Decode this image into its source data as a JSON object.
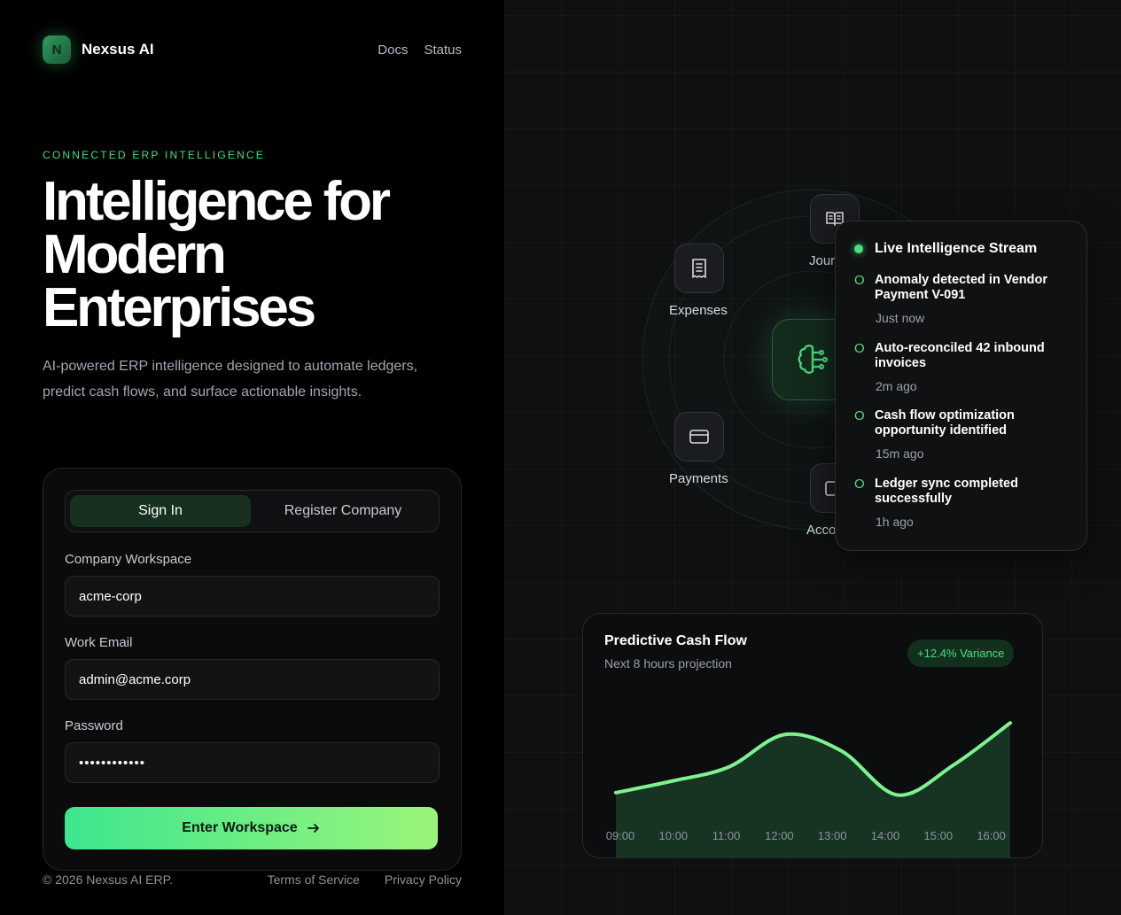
{
  "brand": {
    "logo_letter": "N",
    "name": "Nexsus AI"
  },
  "nav": {
    "docs": "Docs",
    "status": "Status"
  },
  "hero": {
    "eyebrow": "CONNECTED ERP INTELLIGENCE",
    "headline_line1": "Intelligence for",
    "headline_line2": "Modern",
    "headline_line3": "Enterprises",
    "subtext": "AI-powered ERP intelligence designed to automate ledgers, predict cash flows, and surface actionable insights."
  },
  "auth": {
    "tabs": {
      "sign_in": "Sign In",
      "register": "Register Company"
    },
    "workspace_label": "Company Workspace",
    "workspace_value": "acme-corp",
    "email_label": "Work Email",
    "email_value": "admin@acme.corp",
    "password_label": "Password",
    "password_value": "••••••••••••",
    "submit_label": "Enter Workspace"
  },
  "footer": {
    "copyright": "© 2026 Nexsus AI ERP.",
    "terms": "Terms of Service",
    "privacy": "Privacy Policy"
  },
  "modules": {
    "journal": {
      "label": "Journal",
      "icon": "book-open-icon"
    },
    "expenses": {
      "label": "Expenses",
      "icon": "receipt-icon"
    },
    "payments": {
      "label": "Payments",
      "icon": "credit-card-icon"
    },
    "accounts": {
      "label": "Accounts",
      "icon": "wallet-icon"
    },
    "core_icon": "brain-circuit-icon"
  },
  "stream": {
    "title": "Live Intelligence Stream",
    "events": [
      {
        "title": "Anomaly detected in Vendor Payment V-091",
        "time": "Just now"
      },
      {
        "title": "Auto-reconciled 42 inbound invoices",
        "time": "2m ago"
      },
      {
        "title": "Cash flow optimization opportunity identified",
        "time": "15m ago"
      },
      {
        "title": "Ledger sync completed successfully",
        "time": "1h ago"
      }
    ]
  },
  "cashflow": {
    "title": "Predictive Cash Flow",
    "subtitle": "Next 8 hours projection",
    "badge": "+12.4% Variance"
  },
  "chart_data": {
    "type": "area",
    "title": "Predictive Cash Flow",
    "categories": [
      "09:00",
      "10:00",
      "11:00",
      "12:00",
      "13:00",
      "14:00",
      "15:00",
      "16:00"
    ],
    "values": [
      10,
      20,
      32,
      60,
      46,
      8,
      34,
      70
    ],
    "ylim": [
      0,
      80
    ],
    "colors": {
      "line": "#7ef28f",
      "fill": "#173321"
    }
  }
}
